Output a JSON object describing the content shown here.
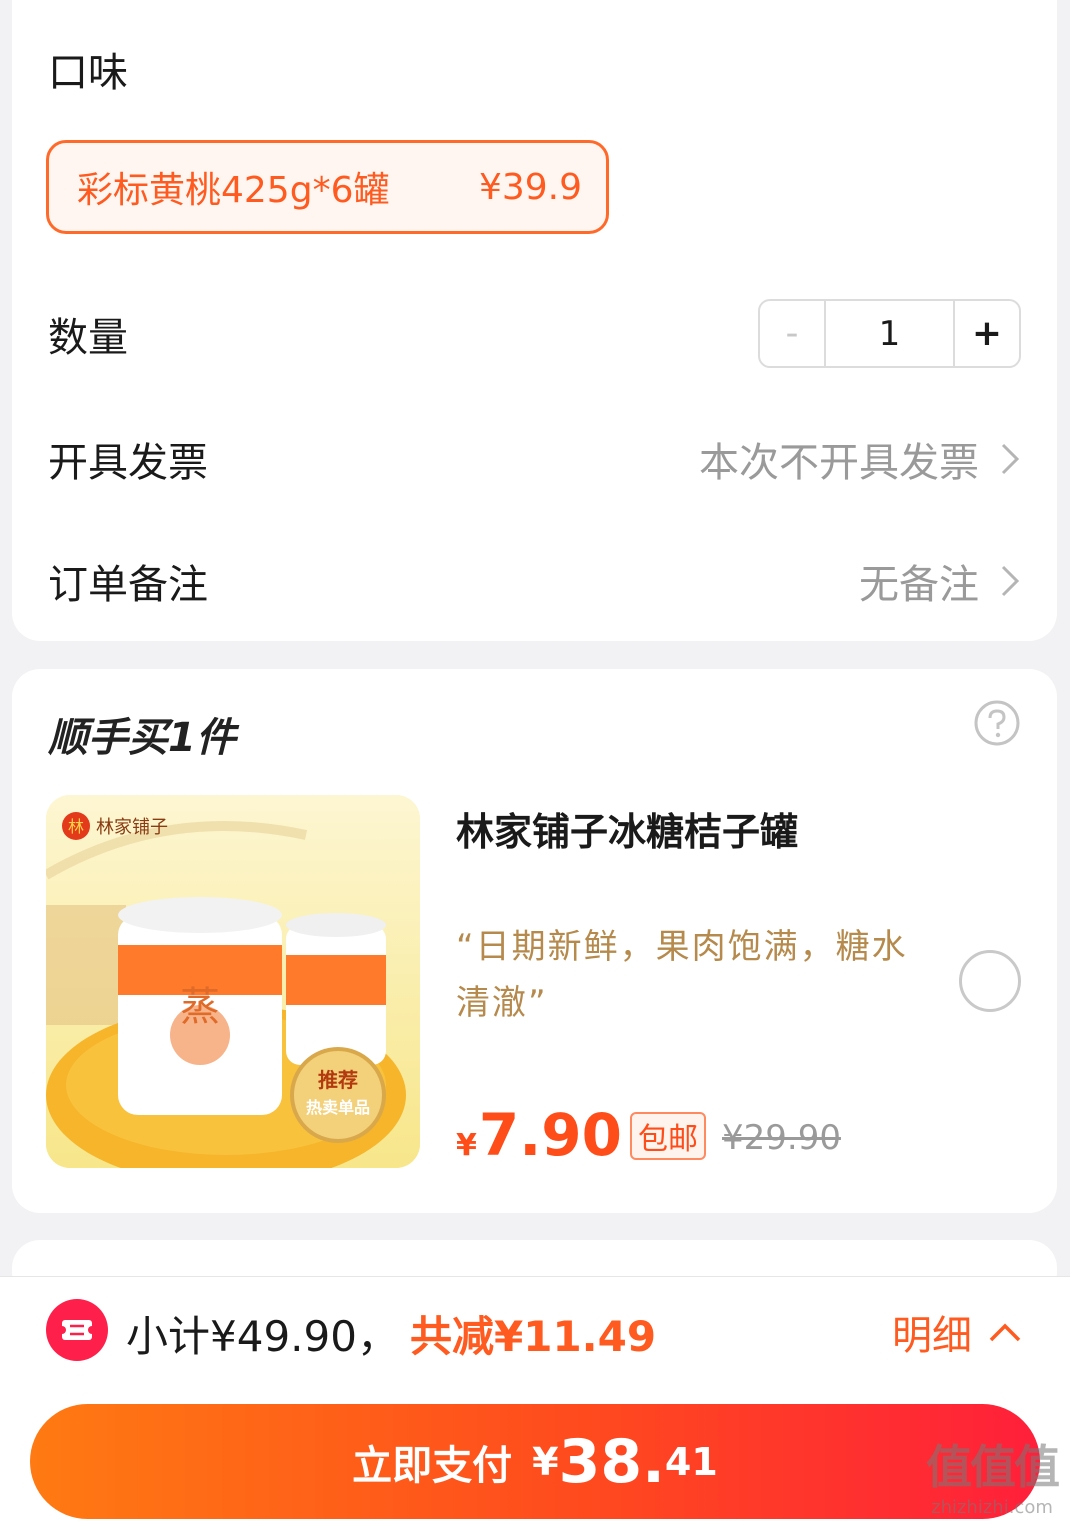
{
  "options": {
    "flavor_label": "口味",
    "flavor_choice": {
      "name": "彩标黄桃425g*6罐",
      "price": "¥39.9"
    },
    "quantity_label": "数量",
    "quantity": {
      "minus": "-",
      "value": "1",
      "plus": "+"
    },
    "invoice_label": "开具发票",
    "invoice_value": "本次不开具发票",
    "remark_label": "订单备注",
    "remark_value": "无备注"
  },
  "addon": {
    "title": "顺手买1件",
    "help_icon": "question-circle-icon",
    "product": {
      "image_brand": "林家铺子",
      "image_badge_line1": "推荐",
      "image_badge_line2": "热卖单品",
      "name": "林家铺子冰糖桔子罐",
      "quote": "“日期新鲜，果肉饱满，糖水清澈”",
      "price_symbol": "¥",
      "price": "7.90",
      "badge": "包邮",
      "original_price": "¥29.90"
    }
  },
  "footer": {
    "subtotal": "小计¥49.90，",
    "discount": "共减¥11.49",
    "detail": "明细",
    "pay": {
      "label": "立即支付",
      "symbol": "¥",
      "integer": "38.",
      "decimal": "41"
    },
    "watermark_big": "值值值",
    "watermark_small": "zhizhizhi.com"
  },
  "colors": {
    "accent": "#ff5a1f",
    "pay_gradient_start": "#ff7a12",
    "pay_gradient_end": "#ff1f3a",
    "quote": "#b58a4c",
    "coupon": "#ff1f4b"
  }
}
